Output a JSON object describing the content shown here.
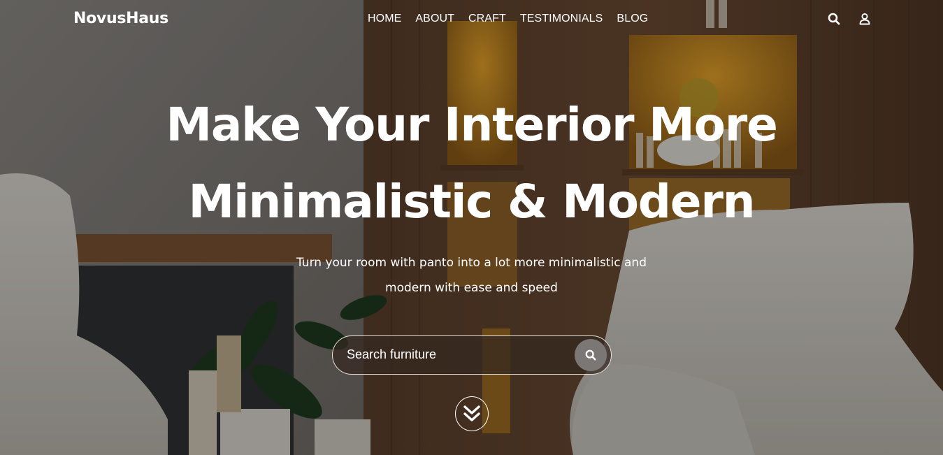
{
  "brand": {
    "name": "NovusHaus"
  },
  "nav": {
    "items": [
      {
        "label": "HOME"
      },
      {
        "label": "ABOUT"
      },
      {
        "label": "CRAFT"
      },
      {
        "label": "TESTIMONIALS"
      },
      {
        "label": "BLOG"
      }
    ]
  },
  "header_icons": {
    "search": "search-icon",
    "user": "user-icon"
  },
  "hero": {
    "headline_line1": "Make Your Interior More",
    "headline_line2": "Minimalistic & Modern",
    "subtitle_line1": "Turn your room with panto into a lot more minimalistic and",
    "subtitle_line2": "modern with ease and speed"
  },
  "search": {
    "placeholder": "Search furniture",
    "value": ""
  },
  "scroll": {
    "icon": "double-chevron-down-icon"
  }
}
